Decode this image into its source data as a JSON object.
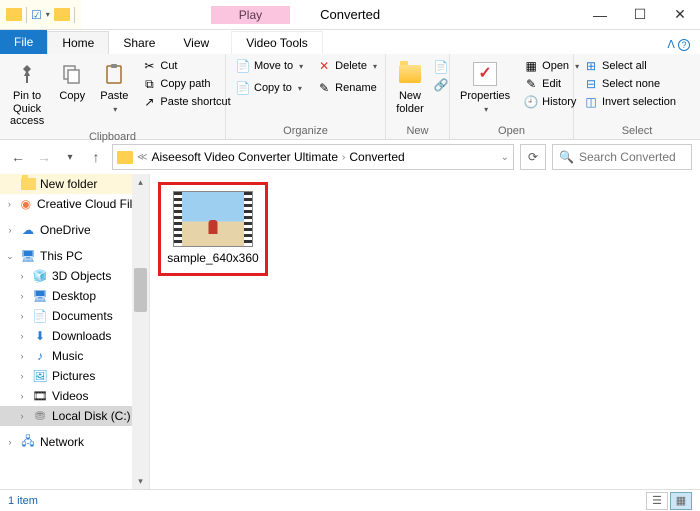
{
  "window": {
    "context_tab": "Play",
    "context_sub": "Video Tools",
    "title": "Converted"
  },
  "tabs": {
    "file": "File",
    "home": "Home",
    "share": "Share",
    "view": "View"
  },
  "ribbon": {
    "clipboard": {
      "label": "Clipboard",
      "pin": "Pin to Quick access",
      "copy": "Copy",
      "paste": "Paste",
      "cut": "Cut",
      "copy_path": "Copy path",
      "paste_shortcut": "Paste shortcut"
    },
    "organize": {
      "label": "Organize",
      "move_to": "Move to",
      "copy_to": "Copy to",
      "delete": "Delete",
      "rename": "Rename"
    },
    "new": {
      "label": "New",
      "new_folder": "New folder"
    },
    "open": {
      "label": "Open",
      "properties": "Properties",
      "open": "Open",
      "edit": "Edit",
      "history": "History"
    },
    "select": {
      "label": "Select",
      "select_all": "Select all",
      "select_none": "Select none",
      "invert": "Invert selection"
    }
  },
  "address": {
    "seg1": "Aiseesoft Video Converter Ultimate",
    "seg2": "Converted",
    "search_placeholder": "Search Converted"
  },
  "tree": {
    "new_folder": "New folder",
    "ccf": "Creative Cloud Files",
    "onedrive": "OneDrive",
    "this_pc": "This PC",
    "objects3d": "3D Objects",
    "desktop": "Desktop",
    "documents": "Documents",
    "downloads": "Downloads",
    "music": "Music",
    "pictures": "Pictures",
    "videos": "Videos",
    "local_disk": "Local Disk (C:)",
    "network": "Network"
  },
  "content": {
    "file1": "sample_640x360"
  },
  "status": {
    "count": "1 item"
  }
}
